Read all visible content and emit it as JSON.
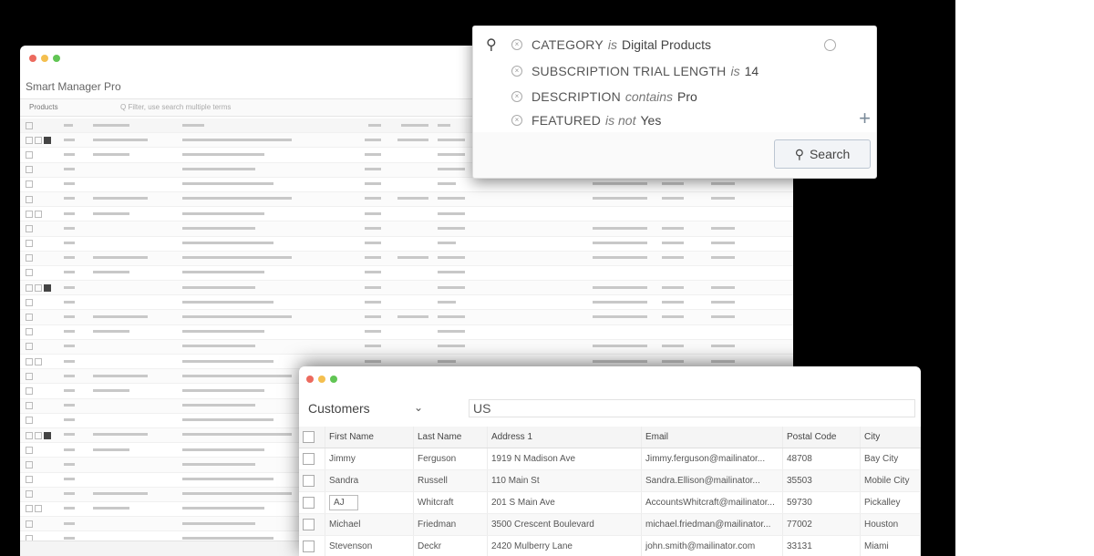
{
  "back_window": {
    "title": "Smart Manager Pro",
    "tab_label": "Products",
    "search_placeholder": "Q  Filter, use search multiple terms",
    "rows": 28
  },
  "search_filter": {
    "filters": [
      {
        "field": "CATEGORY",
        "operator": "is",
        "value": "Digital Products"
      },
      {
        "field": "SUBSCRIPTION TRIAL LENGTH",
        "operator": "is",
        "value": "14"
      },
      {
        "field": "DESCRIPTION",
        "operator": "contains",
        "value": "Pro"
      },
      {
        "field": "FEATURED",
        "operator": "is not",
        "value": "Yes"
      }
    ],
    "add_label": "+",
    "search_button": "Search"
  },
  "customers": {
    "entity": "Customers",
    "search_value": "US",
    "columns": [
      "First Name",
      "Last Name",
      "Address 1",
      "Email",
      "Postal Code",
      "City"
    ],
    "rows": [
      {
        "first": "Jimmy",
        "last": "Ferguson",
        "address": "1919 N Madison Ave",
        "email": "Jimmy.ferguson@mailinator...",
        "postal": "48708",
        "city": "Bay City"
      },
      {
        "first": "Sandra",
        "last": "Russell",
        "address": "110 Main St",
        "email": "Sandra.Ellison@mailinator...",
        "postal": "35503",
        "city": "Mobile City"
      },
      {
        "first": "AJ",
        "last": "Whitcraft",
        "address": "201 S Main Ave",
        "email": "AccountsWhitcraft@mailinator...",
        "postal": "59730",
        "city": "Pickalley"
      },
      {
        "first": "Michael",
        "last": "Friedman",
        "address": "3500 Crescent Boulevard",
        "email": "michael.friedman@mailinator...",
        "postal": "77002",
        "city": "Houston"
      },
      {
        "first": "Stevenson",
        "last": "Deckr",
        "address": "2420 Mulberry Lane",
        "email": "john.smith@mailinator.com",
        "postal": "33131",
        "city": "Miami"
      }
    ]
  }
}
